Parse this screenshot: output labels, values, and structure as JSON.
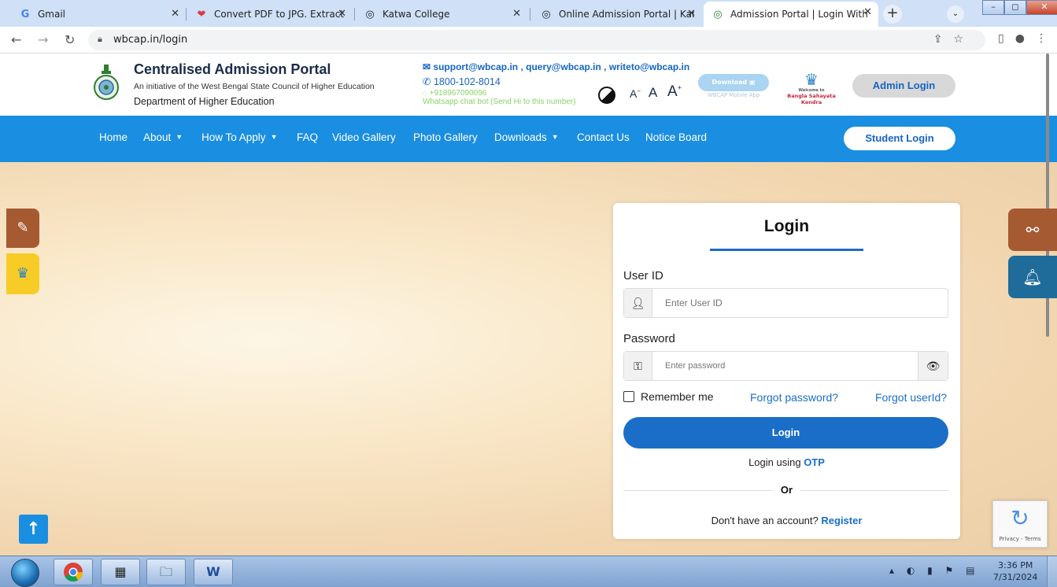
{
  "browser": {
    "tabs": [
      {
        "title": "Gmail",
        "favicon": "gmail-icon"
      },
      {
        "title": "Convert PDF to JPG. Extract im",
        "favicon": "heart-icon"
      },
      {
        "title": "Katwa College",
        "favicon": "globe-icon"
      },
      {
        "title": "Online Admission Portal | Katv",
        "favicon": "globe-icon"
      },
      {
        "title": "Admission Portal | Login With",
        "favicon": "globe-icon",
        "active": true
      }
    ],
    "url": "wbcap.in/login"
  },
  "header": {
    "title": "Centralised Admission Portal",
    "subtitle": "An initiative of the West Bengal State Council of Higher Education",
    "department": "Department of Higher Education",
    "email": "support@wbcap.in , query@wbcap.in , writeto@wbcap.in",
    "phone": "1800-102-8014",
    "whatsapp_number": "+918967090096",
    "whatsapp_note": "Whatsapp chat bot (Send Hi to this number)",
    "font_small": "A",
    "font_normal": "A",
    "font_large": "A",
    "download_label": "Download",
    "download_caption": "WBCAP Mobile App",
    "bsk_top": "Welcome to",
    "bsk_label": "Bangla Sahayata Kendra",
    "admin_login": "Admin Login"
  },
  "nav": {
    "items": [
      {
        "label": "Home",
        "dropdown": false
      },
      {
        "label": "About",
        "dropdown": true
      },
      {
        "label": "How To Apply",
        "dropdown": true
      },
      {
        "label": "FAQ",
        "dropdown": false
      },
      {
        "label": "Video Gallery",
        "dropdown": false
      },
      {
        "label": "Photo Gallery",
        "dropdown": false
      },
      {
        "label": "Downloads",
        "dropdown": true
      },
      {
        "label": "Contact Us",
        "dropdown": false
      },
      {
        "label": "Notice Board",
        "dropdown": false
      }
    ],
    "student_login": "Student Login"
  },
  "login": {
    "title": "Login",
    "userid_label": "User ID",
    "userid_placeholder": "Enter User ID",
    "password_label": "Password",
    "password_placeholder": "Enter password",
    "remember_label": "Remember me",
    "forgot_password": "Forgot password?",
    "forgot_userid": "Forgot userId?",
    "submit_label": "Login",
    "otp_prefix": "Login using",
    "otp_link": "OTP",
    "or_label": "Or",
    "register_prefix": "Don't have an account?",
    "register_link": "Register"
  },
  "recaptcha": {
    "label": "Privacy - Terms"
  },
  "taskbar": {
    "time": "3:36 PM",
    "date": "7/31/2024"
  },
  "colors": {
    "nav_blue": "#1a8ee0",
    "primary_blue": "#1a6ec8",
    "brand_dark": "#1a2c4a"
  }
}
